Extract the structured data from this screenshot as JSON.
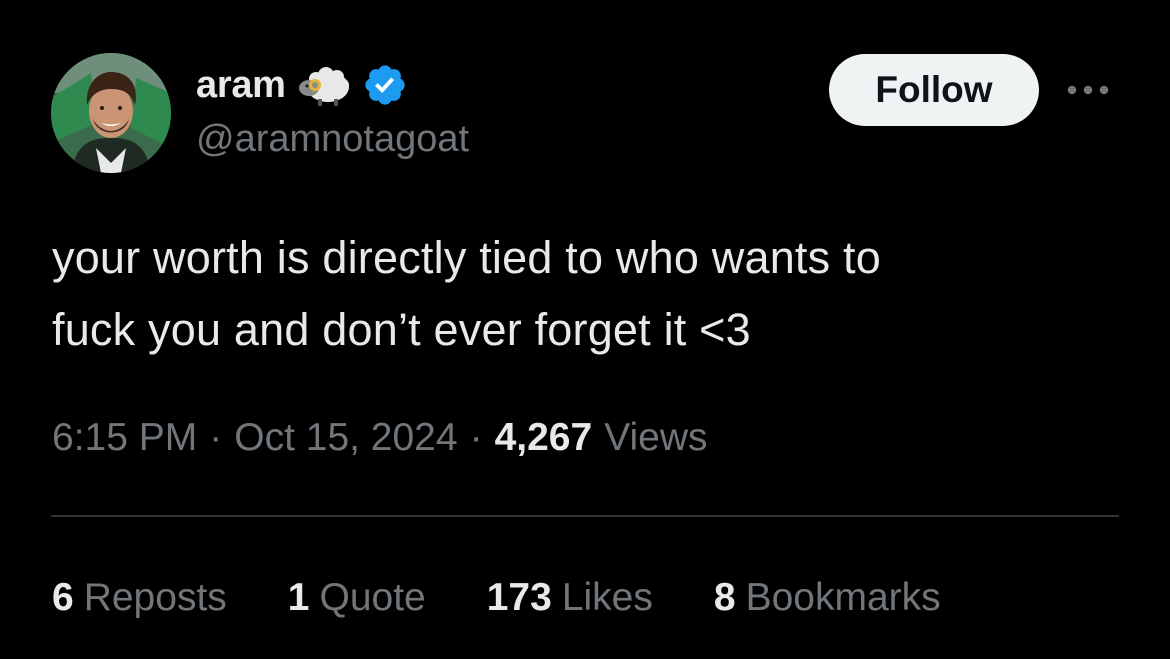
{
  "author": {
    "display_name": "aram",
    "handle": "@aramnotagoat",
    "verified": true,
    "badge_emoji_icon": "ram-icon",
    "verified_color": "#1d9bf0"
  },
  "follow_button": {
    "label": "Follow"
  },
  "more_menu": {
    "icon": "more-horizontal-icon"
  },
  "tweet": {
    "line1": "your worth is directly tied to who wants to",
    "line2": "fuck you and don’t ever forget it <3"
  },
  "meta": {
    "time": "6:15 PM",
    "separator": "·",
    "date": "Oct 15, 2024",
    "views_count": "4,267",
    "views_label": "Views"
  },
  "stats": {
    "reposts": {
      "count": "6",
      "label": "Reposts"
    },
    "quotes": {
      "count": "1",
      "label": "Quote"
    },
    "likes": {
      "count": "173",
      "label": "Likes"
    },
    "bookmarks": {
      "count": "8",
      "label": "Bookmarks"
    }
  },
  "colors": {
    "background": "#000000",
    "primary_text": "#e7e9ea",
    "secondary_text": "#71767b",
    "divider": "#2f3336",
    "follow_bg": "#eff3f4",
    "follow_text": "#0f1419"
  }
}
